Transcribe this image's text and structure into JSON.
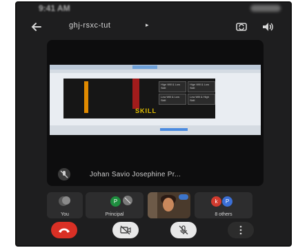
{
  "status": {
    "time": "9:41 AM"
  },
  "header": {
    "meeting_code": "ghj-rsxc-tut",
    "caret": "▸"
  },
  "presenter": {
    "name": "Johan Savio Josephine Pr..."
  },
  "shared_slide": {
    "cells": [
      "Hign Will & Low Skill",
      "Hign Will & Low Skill",
      "Low Will & Low Skill",
      "Low Will & High Skill"
    ],
    "title": "SKILL"
  },
  "participants": [
    {
      "label": "You"
    },
    {
      "label": "Principal",
      "avatar": "P"
    },
    {
      "label": ""
    },
    {
      "label": "8 others",
      "avatars": [
        "k",
        "P"
      ]
    }
  ],
  "colors": {
    "end_call": "#d93025",
    "avatar_green": "#1e8e3e",
    "avatar_red": "#d23b2f",
    "avatar_blue": "#3b6fd6",
    "speaking_badge": "#3c74c9"
  }
}
